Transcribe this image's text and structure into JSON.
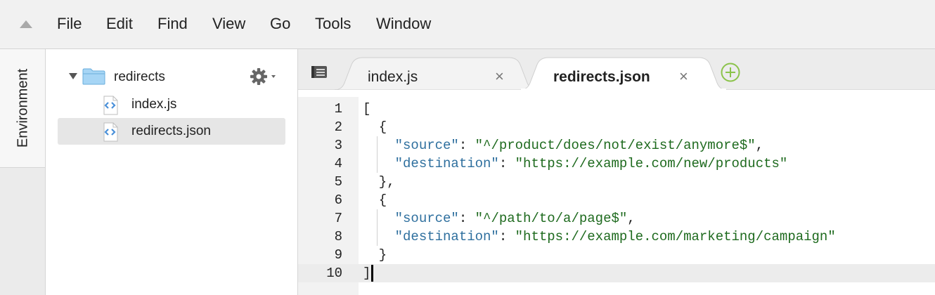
{
  "menubar": {
    "items": [
      "File",
      "Edit",
      "Find",
      "View",
      "Go",
      "Tools",
      "Window"
    ]
  },
  "side_tabs": {
    "environment": "Environment"
  },
  "tree": {
    "folder": "redirects",
    "files": [
      "index.js",
      "redirects.json"
    ],
    "selected": "redirects.json"
  },
  "editor": {
    "tabs": [
      {
        "label": "index.js",
        "close": "×",
        "active": false
      },
      {
        "label": "redirects.json",
        "close": "×",
        "active": true
      }
    ],
    "lines": [
      {
        "no": "1",
        "tokens": [
          [
            "p",
            "["
          ]
        ]
      },
      {
        "no": "2",
        "tokens": [
          [
            "p",
            "  {"
          ]
        ]
      },
      {
        "no": "3",
        "tokens": [
          [
            "p",
            "    "
          ],
          [
            "k",
            "\"source\""
          ],
          [
            "p",
            ": "
          ],
          [
            "s",
            "\"^/product/does/not/exist/anymore$\""
          ],
          [
            "p",
            ","
          ]
        ]
      },
      {
        "no": "4",
        "tokens": [
          [
            "p",
            "    "
          ],
          [
            "k",
            "\"destination\""
          ],
          [
            "p",
            ": "
          ],
          [
            "s",
            "\"https://example.com/new/products\""
          ]
        ]
      },
      {
        "no": "5",
        "tokens": [
          [
            "p",
            "  },"
          ]
        ]
      },
      {
        "no": "6",
        "tokens": [
          [
            "p",
            "  {"
          ]
        ]
      },
      {
        "no": "7",
        "tokens": [
          [
            "p",
            "    "
          ],
          [
            "k",
            "\"source\""
          ],
          [
            "p",
            ": "
          ],
          [
            "s",
            "\"^/path/to/a/page$\""
          ],
          [
            "p",
            ","
          ]
        ]
      },
      {
        "no": "8",
        "tokens": [
          [
            "p",
            "    "
          ],
          [
            "k",
            "\"destination\""
          ],
          [
            "p",
            ": "
          ],
          [
            "s",
            "\"https://example.com/marketing/campaign\""
          ]
        ]
      },
      {
        "no": "9",
        "tokens": [
          [
            "p",
            "  }"
          ]
        ]
      },
      {
        "no": "10",
        "tokens": [
          [
            "p",
            "]"
          ]
        ]
      }
    ],
    "current_line": "10"
  },
  "colors": {
    "json_key": "#2e6f9e",
    "json_string": "#1e6a1e",
    "add_tab_accent": "#8bc34a",
    "file_icon_accent": "#4a90d9",
    "folder": "#9fd0f2"
  },
  "icons": {
    "collapse": "triangle-up-icon",
    "folder": "folder-icon",
    "file": "code-file-icon",
    "settings": "gear-icon",
    "tab_list": "list-icon",
    "new_tab": "plus-circle-icon"
  }
}
